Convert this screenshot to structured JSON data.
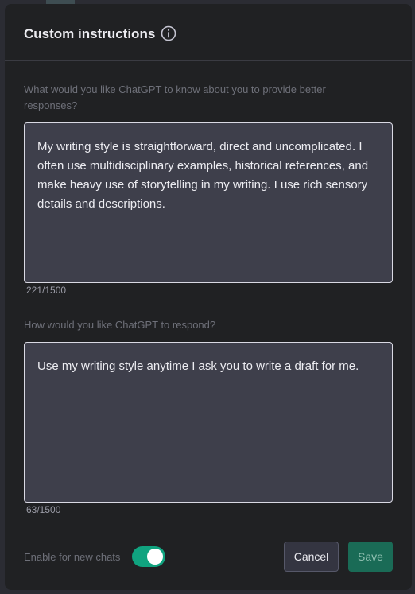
{
  "modal": {
    "title": "Custom instructions",
    "info_icon": "info-circle-icon"
  },
  "about_you": {
    "question": "What would you like ChatGPT to know about you to provide better responses?",
    "value": "My writing style is straightforward, direct and uncomplicated.  I often use multidisciplinary examples, historical references, and make heavy use of storytelling in my writing. I use rich sensory details and descriptions.",
    "counter": "221/1500"
  },
  "respond": {
    "question": "How would you like ChatGPT to respond?",
    "value": "Use my writing style anytime I ask you to write a draft for me.",
    "counter": "63/1500"
  },
  "footer": {
    "enable_label": "Enable for new chats",
    "enabled": true,
    "cancel_label": "Cancel",
    "save_label": "Save"
  },
  "colors": {
    "accent": "#10a37f",
    "modal_bg": "#202123",
    "input_bg": "#3e3f4b"
  }
}
